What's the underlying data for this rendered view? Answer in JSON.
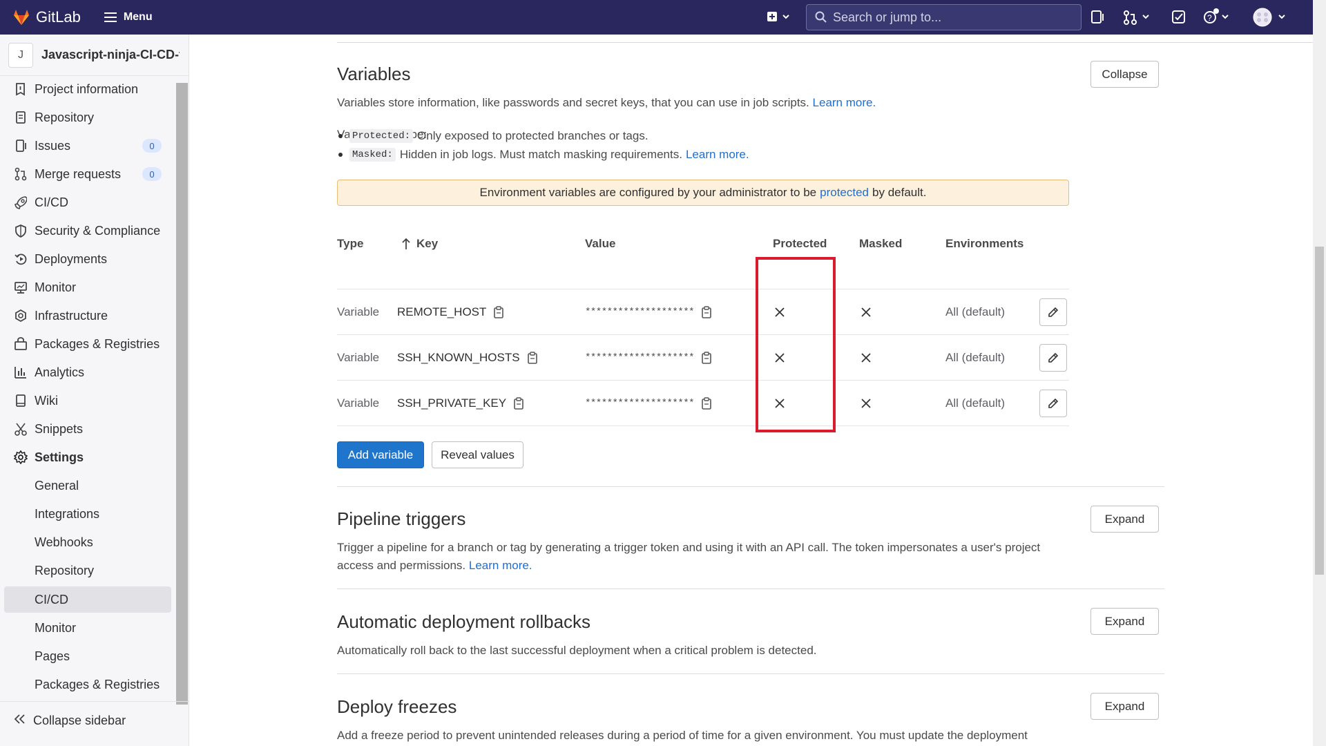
{
  "topbar": {
    "brand": "GitLab",
    "menu_label": "Menu",
    "search_placeholder": "Search or jump to..."
  },
  "sidebar": {
    "project_initial": "J",
    "project_name": "Javascript-ninja-CI-CD-f...",
    "items": [
      {
        "label": "Project information",
        "icon": "info-icon"
      },
      {
        "label": "Repository",
        "icon": "file-icon"
      },
      {
        "label": "Issues",
        "icon": "issues-icon",
        "count": "0"
      },
      {
        "label": "Merge requests",
        "icon": "merge-request-icon",
        "count": "0"
      },
      {
        "label": "CI/CD",
        "icon": "rocket-icon"
      },
      {
        "label": "Security & Compliance",
        "icon": "shield-icon"
      },
      {
        "label": "Deployments",
        "icon": "deployments-icon"
      },
      {
        "label": "Monitor",
        "icon": "monitor-icon"
      },
      {
        "label": "Infrastructure",
        "icon": "cloud-icon"
      },
      {
        "label": "Packages & Registries",
        "icon": "package-icon"
      },
      {
        "label": "Analytics",
        "icon": "chart-icon"
      },
      {
        "label": "Wiki",
        "icon": "book-icon"
      },
      {
        "label": "Snippets",
        "icon": "scissors-icon"
      },
      {
        "label": "Settings",
        "icon": "gear-icon"
      }
    ],
    "settings_sub": [
      "General",
      "Integrations",
      "Webhooks",
      "Repository",
      "CI/CD",
      "Monitor",
      "Pages",
      "Packages & Registries"
    ],
    "collapse_label": "Collapse sidebar"
  },
  "variables": {
    "title": "Variables",
    "collapse_btn": "Collapse",
    "desc": "Variables store information, like passwords and secret keys, that you can use in job scripts.",
    "learn_more": "Learn more.",
    "can_be": "Variables can be:",
    "protected_code": "Protected:",
    "protected_desc": "Only exposed to protected branches or tags.",
    "masked_code": "Masked:",
    "masked_desc": "Hidden in job logs. Must match masking requirements.",
    "banner_pre": "Environment variables are configured by your administrator to be",
    "banner_link": "protected",
    "banner_post": "by default.",
    "headers": {
      "type": "Type",
      "key": "Key",
      "value": "Value",
      "protected": "Protected",
      "masked": "Masked",
      "environments": "Environments"
    },
    "rows": [
      {
        "type": "Variable",
        "key": "REMOTE_HOST",
        "value": "********************",
        "env": "All (default)"
      },
      {
        "type": "Variable",
        "key": "SSH_KNOWN_HOSTS",
        "value": "********************",
        "env": "All (default)"
      },
      {
        "type": "Variable",
        "key": "SSH_PRIVATE_KEY",
        "value": "********************",
        "env": "All (default)"
      }
    ],
    "add_btn": "Add variable",
    "reveal_btn": "Reveal values"
  },
  "pipeline_triggers": {
    "title": "Pipeline triggers",
    "expand_btn": "Expand",
    "desc_line1": "Trigger a pipeline for a branch or tag by generating a trigger token and using it with an API call. The token impersonates a user's project",
    "desc_line2": "access and permissions.",
    "learn_more": "Learn more."
  },
  "rollbacks": {
    "title": "Automatic deployment rollbacks",
    "expand_btn": "Expand",
    "desc": "Automatically roll back to the last successful deployment when a critical problem is detected."
  },
  "freezes": {
    "title": "Deploy freezes",
    "expand_btn": "Expand",
    "desc": "Add a freeze period to prevent unintended releases during a period of time for a given environment. You must update the deployment"
  },
  "colors": {
    "topbar": "#29275e",
    "accent": "#1f75cb",
    "highlight": "#d81c2b"
  }
}
